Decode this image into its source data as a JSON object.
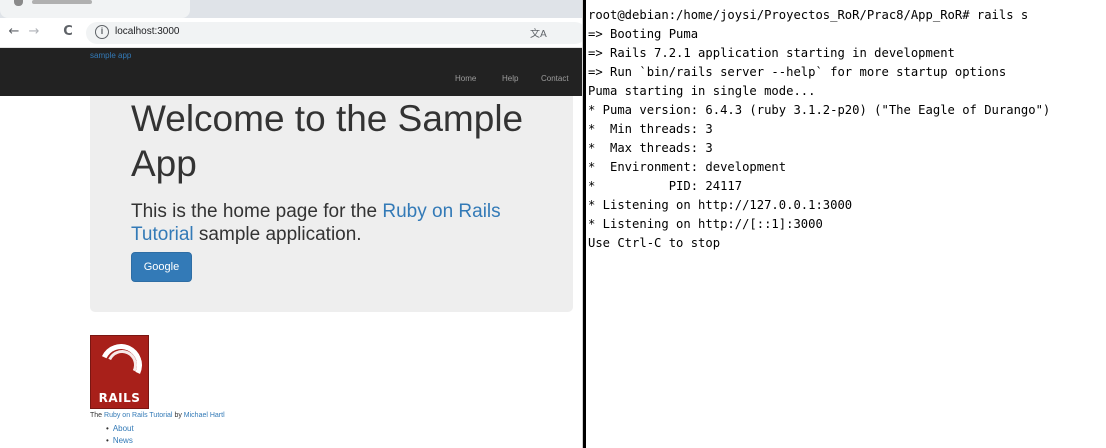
{
  "browser": {
    "address_bar": {
      "url": "localhost:3000"
    },
    "nav": {
      "back_icon": "←",
      "forward_icon": "→",
      "reload_icon": "C"
    }
  },
  "site": {
    "logo": "sample app",
    "nav_links": [
      "Home",
      "Help",
      "Contact"
    ],
    "jumbotron": {
      "heading": "Welcome to the Sample App",
      "subheading_prefix": "This is the home page for the ",
      "subheading_link": "Ruby on Rails Tutorial",
      "subheading_suffix": " sample application.",
      "button_label": "Google"
    },
    "rails_logo_text": "RAILS",
    "footer": {
      "prefix": "The ",
      "tutorial_link": "Ruby on Rails Tutorial",
      "by": " by ",
      "author_link": "Michael Hartl",
      "links": [
        "About",
        "News"
      ]
    },
    "colors": {
      "navbar": "#222222",
      "link": "#337ab7",
      "button": "#337ab7",
      "jumbotron": "#eeeeee"
    }
  },
  "terminal": {
    "lines": [
      "root@debian:/home/joysi/Proyectos_RoR/Prac8/App_RoR# rails s",
      "=> Booting Puma",
      "=> Rails 7.2.1 application starting in development",
      "=> Run `bin/rails server --help` for more startup options",
      "Puma starting in single mode...",
      "* Puma version: 6.4.3 (ruby 3.1.2-p20) (\"The Eagle of Durango\")",
      "*  Min threads: 3",
      "*  Max threads: 3",
      "*  Environment: development",
      "*          PID: 24117",
      "* Listening on http://127.0.0.1:3000",
      "* Listening on http://[::1]:3000",
      "Use Ctrl-C to stop"
    ]
  }
}
